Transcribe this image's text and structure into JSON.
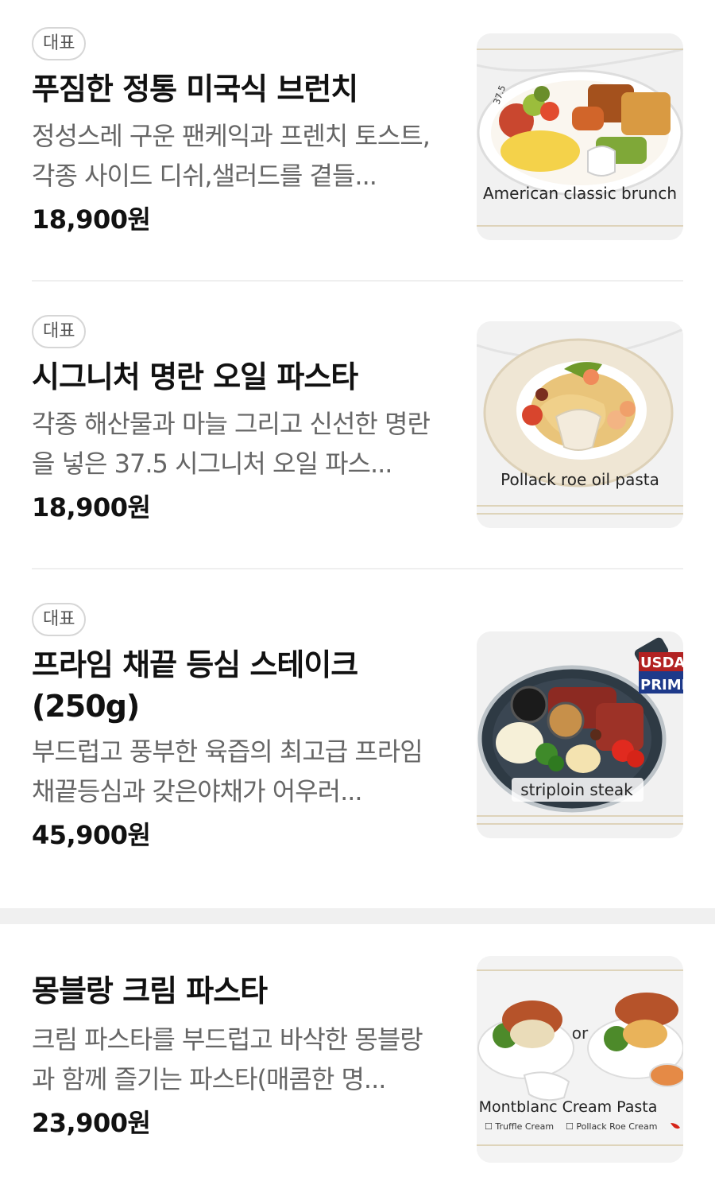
{
  "menu": [
    {
      "badge": "대표",
      "name": "푸짐한 정통 미국식 브런치",
      "description": "정성스레 구운 팬케익과 프렌치 토스트,각종 사이드 디쉬,샐러드를 곁들...",
      "price": "18,900원",
      "image_caption": "American classic brunch",
      "image_mark": "37.5"
    },
    {
      "badge": "대표",
      "name": "시그니처 명란 오일 파스타",
      "description": "각종 해산물과 마늘 그리고 신선한 명란을 넣은 37.5 시그니처 오일 파스...",
      "price": "18,900원",
      "image_caption": "Pollack roe oil pasta"
    },
    {
      "badge": "대표",
      "name": "프라임 채끝 등심 스테이크(250g)",
      "description": "부드럽고 풍부한 육즙의 최고급 프라임 채끝등심과 갖은야채가 어우러...",
      "price": "45,900원",
      "image_caption": "striploin steak",
      "image_flag_top": "USDA",
      "image_flag_bottom": "PRIME"
    },
    {
      "name": "몽블랑 크림 파스타",
      "description": "크림 파스타를 부드럽고 바삭한 몽블랑과 함께 즐기는 파스타(매콤한 명...",
      "price": "23,900원",
      "image_caption": "Montblanc Cream Pasta",
      "image_or": "or",
      "image_option1": "☐ Truffle Cream",
      "image_option2": "☐ Pollack Roe Cream"
    }
  ],
  "colors": {
    "text_primary": "#111111",
    "text_secondary": "#666666",
    "badge_border": "#d6d6d6",
    "divider": "#efefef",
    "section_gap": "#f0f0f0"
  }
}
